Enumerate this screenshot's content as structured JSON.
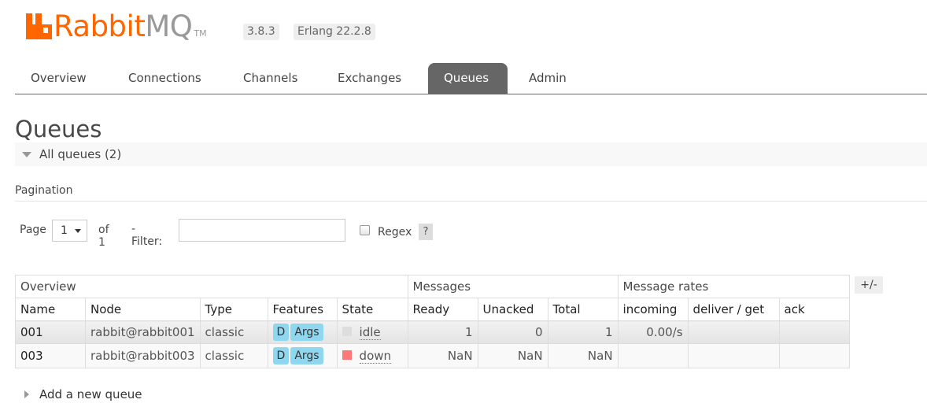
{
  "header": {
    "logo_rabbit": "Rabbit",
    "logo_mq": "MQ",
    "logo_tm": "TM",
    "version": "3.8.3",
    "erlang": "Erlang 22.2.8"
  },
  "nav": {
    "tabs": [
      {
        "label": "Overview"
      },
      {
        "label": "Connections"
      },
      {
        "label": "Channels"
      },
      {
        "label": "Exchanges"
      },
      {
        "label": "Queues"
      },
      {
        "label": "Admin"
      }
    ],
    "active": "Queues"
  },
  "page": {
    "title": "Queues",
    "section_header": "All queues (2)",
    "pagination_label": "Pagination"
  },
  "pagination": {
    "page_label": "Page",
    "page_value": "1",
    "of_label": "of 1",
    "filter_label": "- Filter:",
    "filter_value": "",
    "regex_label": "Regex",
    "regex_checked": false,
    "help_label": "?"
  },
  "table": {
    "groups": {
      "overview": "Overview",
      "messages": "Messages",
      "rates": "Message rates"
    },
    "columns": {
      "name": "Name",
      "node": "Node",
      "type": "Type",
      "features": "Features",
      "state": "State",
      "ready": "Ready",
      "unacked": "Unacked",
      "total": "Total",
      "incoming": "incoming",
      "deliver_get": "deliver / get",
      "ack": "ack"
    },
    "toggle_columns_label": "+/-",
    "rows": [
      {
        "name": "001",
        "node": "rabbit@rabbit001",
        "type": "classic",
        "feature_d": "D",
        "feature_args": "Args",
        "state": "idle",
        "state_color": "#dddddd",
        "ready": "1",
        "unacked": "0",
        "total": "1",
        "incoming": "0.00/s",
        "deliver_get": "",
        "ack": ""
      },
      {
        "name": "003",
        "node": "rabbit@rabbit003",
        "type": "classic",
        "feature_d": "D",
        "feature_args": "Args",
        "state": "down",
        "state_color": "#ff7777",
        "ready": "NaN",
        "unacked": "NaN",
        "total": "NaN",
        "incoming": "",
        "deliver_get": "",
        "ack": ""
      }
    ]
  },
  "footer": {
    "add_queue": "Add a new queue"
  },
  "colors": {
    "brand_orange": "#ff6600",
    "nav_active_bg": "#666666",
    "feature_badge": "#8ed7ef"
  }
}
